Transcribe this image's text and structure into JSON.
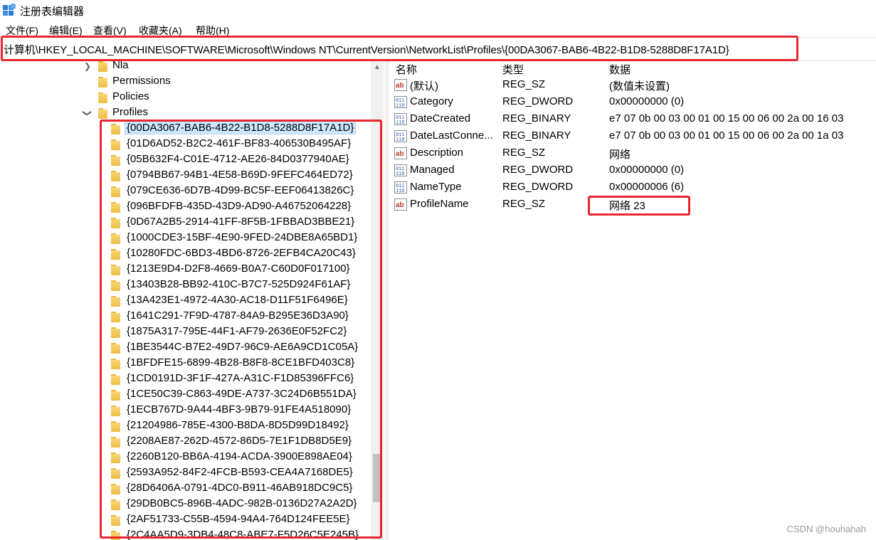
{
  "window": {
    "title": "注册表编辑器"
  },
  "menu": [
    "文件(F)",
    "编辑(E)",
    "查看(V)",
    "收藏夹(A)",
    "帮助(H)"
  ],
  "address": "计算机\\HKEY_LOCAL_MACHINE\\SOFTWARE\\Microsoft\\Windows NT\\CurrentVersion\\NetworkList\\Profiles\\{00DA3067-BAB6-4B22-B1D8-5288D8F17A1D}",
  "tree": {
    "parents": [
      {
        "label": "Nla",
        "expander": "collapsed"
      },
      {
        "label": "Permissions",
        "expander": "none"
      },
      {
        "label": "Policies",
        "expander": "none"
      },
      {
        "label": "Profiles",
        "expander": "expanded"
      }
    ],
    "profiles": [
      "{00DA3067-BAB6-4B22-B1D8-5288D8F17A1D}",
      "{01D6AD52-B2C2-461F-BF83-406530B495AF}",
      "{05B632F4-C01E-4712-AE26-84D0377940AE}",
      "{0794BB67-94B1-4E58-B69D-9FEFC464ED72}",
      "{079CE636-6D7B-4D99-BC5F-EEF06413826C}",
      "{096BFDFB-435D-43D9-AD90-A46752064228}",
      "{0D67A2B5-2914-41FF-8F5B-1FBBAD3BBE21}",
      "{1000CDE3-15BF-4E90-9FED-24DBE8A65BD1}",
      "{10280FDC-6BD3-4BD6-8726-2EFB4CA20C43}",
      "{1213E9D4-D2F8-4669-B0A7-C60D0F017100}",
      "{13403B28-BB92-410C-B7C7-525D924F61AF}",
      "{13A423E1-4972-4A30-AC18-D11F51F6496E}",
      "{1641C291-7F9D-4787-84A9-B295E36D3A90}",
      "{1875A317-795E-44F1-AF79-2636E0F52FC2}",
      "{1BE3544C-B7E2-49D7-96C9-AE6A9CD1C05A}",
      "{1BFDFE15-6899-4B28-B8F8-8CE1BFD403C8}",
      "{1CD0191D-3F1F-427A-A31C-F1D85396FFC6}",
      "{1CE50C39-C863-49DE-A737-3C24D6B551DA}",
      "{1ECB767D-9A44-4BF3-9B79-91FE4A518090}",
      "{21204986-785E-4300-B8DA-8D5D99D18492}",
      "{2208AE87-262D-4572-86D5-7E1F1DB8D5E9}",
      "{2260B120-BB6A-4194-ACDA-3900E898AE04}",
      "{2593A952-84F2-4FCB-B593-CEA4A7168DE5}",
      "{28D6406A-0791-4DC0-B911-46AB918DC9C5}",
      "{29DB0BC5-896B-4ADC-982B-0136D27A2A2D}",
      "{2AF51733-C55B-4594-94A4-764D124FEE5E}",
      "{2C4AA5D9-3DB4-48C8-ABE7-F5D26C5E245B}"
    ]
  },
  "values": {
    "headers": [
      "名称",
      "类型",
      "数据"
    ],
    "rows": [
      {
        "icon": "string-value-icon",
        "name": "(默认)",
        "type": "REG_SZ",
        "data": "(数值未设置)"
      },
      {
        "icon": "binary-value-icon",
        "name": "Category",
        "type": "REG_DWORD",
        "data": "0x00000000 (0)"
      },
      {
        "icon": "binary-value-icon",
        "name": "DateCreated",
        "type": "REG_BINARY",
        "data": "e7 07 0b 00 03 00 01 00 15 00 06 00 2a 00 16 03"
      },
      {
        "icon": "binary-value-icon",
        "name": "DateLastConne...",
        "type": "REG_BINARY",
        "data": "e7 07 0b 00 03 00 01 00 15 00 06 00 2a 00 1a 03"
      },
      {
        "icon": "string-value-icon",
        "name": "Description",
        "type": "REG_SZ",
        "data": "网络"
      },
      {
        "icon": "binary-value-icon",
        "name": "Managed",
        "type": "REG_DWORD",
        "data": "0x00000000 (0)"
      },
      {
        "icon": "binary-value-icon",
        "name": "NameType",
        "type": "REG_DWORD",
        "data": "0x00000006 (6)"
      },
      {
        "icon": "string-value-icon",
        "name": "ProfileName",
        "type": "REG_SZ",
        "data": "网络 23"
      }
    ]
  },
  "watermark": "CSDN @houhahah",
  "colors": {
    "highlight": "#e8262b",
    "selection": "#cce8ff",
    "folder": "#f0c050"
  }
}
